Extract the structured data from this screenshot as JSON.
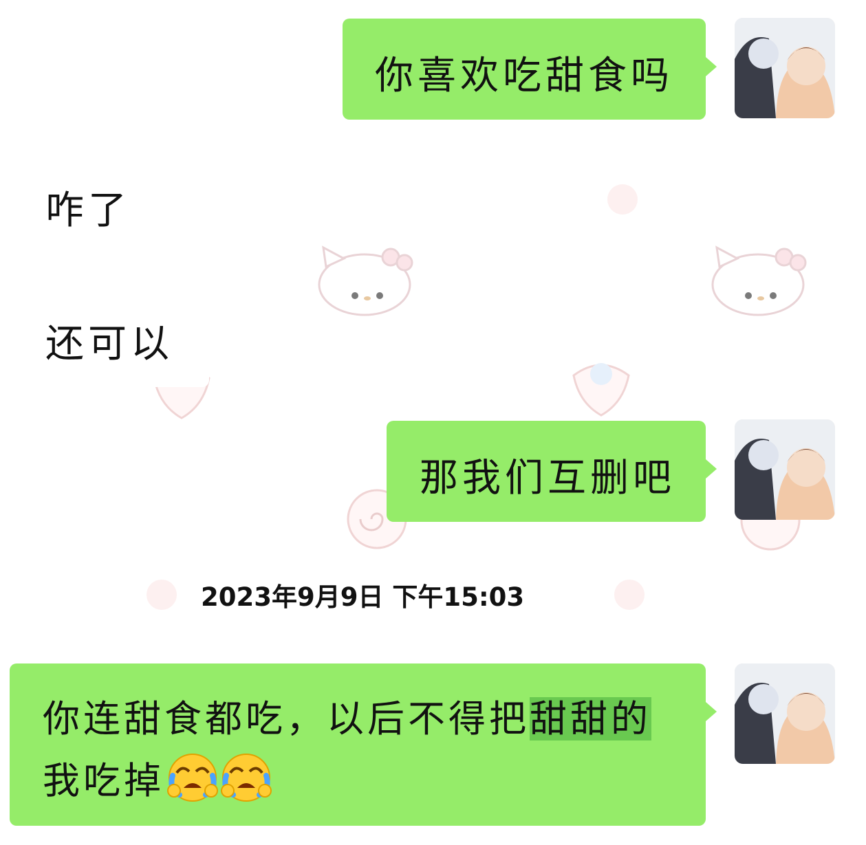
{
  "messages": [
    {
      "sender": "me",
      "text": "你喜欢吃甜食吗"
    },
    {
      "sender": "other",
      "text": "咋了"
    },
    {
      "sender": "other",
      "text": "还可以"
    },
    {
      "sender": "me",
      "text": "那我们互删吧"
    },
    {
      "sender": "me",
      "line1_plain": "你连甜食都吃，以后不得把",
      "line1_highlight": "甜甜的",
      "line2": "我吃掉",
      "emoji": [
        "crying-face-icon",
        "crying-face-icon"
      ]
    }
  ],
  "timestamp": "2023年9月9日 下午15:03",
  "colors": {
    "my_bubble": "#95ec69",
    "their_bubble": "#ffffff",
    "highlight": "#3fb23f",
    "background": "#ffffff"
  }
}
